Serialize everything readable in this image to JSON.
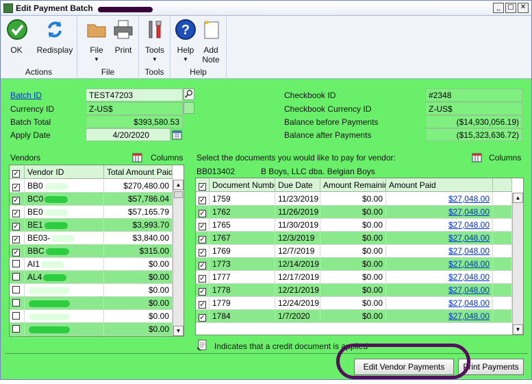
{
  "window": {
    "title": "Edit Payment Batch",
    "min": "_",
    "max": "□",
    "close": "✕"
  },
  "ribbon": {
    "ok": "OK",
    "redisplay": "Redisplay",
    "actions_label": "Actions",
    "file": "File",
    "print": "Print",
    "file_label": "File",
    "tools": "Tools",
    "tools_label": "Tools",
    "help": "Help",
    "add_note_1": "Add",
    "add_note_2": "Note",
    "help_label": "Help"
  },
  "header": {
    "batch_id_label": "Batch ID",
    "batch_id": "TEST47203",
    "currency_id_label": "Currency ID",
    "currency_id": "Z-US$",
    "batch_total_label": "Batch Total",
    "batch_total": "$393,580.53",
    "apply_date_label": "Apply Date",
    "apply_date": "4/20/2020",
    "checkbook_id_label": "Checkbook ID",
    "checkbook_id": "#2348",
    "checkbook_currency_label": "Checkbook Currency ID",
    "checkbook_currency": "Z-US$",
    "balance_before_label": "Balance before Payments",
    "balance_before": "($14,930,056.19)",
    "balance_after_label": "Balance after Payments",
    "balance_after": "($15,323,636.72)"
  },
  "vendors": {
    "title": "Vendors",
    "columns_label": "Columns",
    "col_vendor": "Vendor ID",
    "col_total": "Total Amount Paid",
    "rows": [
      {
        "id": "BB0",
        "amount": "$270,480.00",
        "checked": true
      },
      {
        "id": "BC0",
        "amount": "$57,786.04",
        "checked": true
      },
      {
        "id": "BE0",
        "amount": "$57,165.79",
        "checked": true
      },
      {
        "id": "BE1",
        "amount": "$3,993.70",
        "checked": true
      },
      {
        "id": "BE03-",
        "amount": "$3,840.00",
        "checked": true
      },
      {
        "id": "BBC",
        "amount": "$315.00",
        "checked": true
      },
      {
        "id": "AI1",
        "amount": "$0.00",
        "checked": false
      },
      {
        "id": "AL4",
        "amount": "$0.00",
        "checked": false
      },
      {
        "id": "",
        "amount": "$0.00",
        "checked": false
      },
      {
        "id": "",
        "amount": "$0.00",
        "checked": false
      },
      {
        "id": "",
        "amount": "$0.00",
        "checked": false
      },
      {
        "id": "",
        "amount": "$0.00",
        "checked": false
      }
    ]
  },
  "documents": {
    "prompt": "Select the documents you would like to pay for vendor:",
    "vendor_id": "BB013402",
    "vendor_name": "B Boys, LLC dba. Belgian Boys",
    "columns_label": "Columns",
    "col_doc": "Document Number",
    "col_due": "Due Date",
    "col_remaining": "Amount Remaining",
    "col_paid": "Amount Paid",
    "rows": [
      {
        "doc": "1759",
        "due": "11/23/2019",
        "remaining": "$0.00",
        "paid": "$27,048.00"
      },
      {
        "doc": "1762",
        "due": "11/26/2019",
        "remaining": "$0.00",
        "paid": "$27,048.00"
      },
      {
        "doc": "1765",
        "due": "11/30/2019",
        "remaining": "$0.00",
        "paid": "$27,048.00"
      },
      {
        "doc": "1767",
        "due": "12/3/2019",
        "remaining": "$0.00",
        "paid": "$27,048.00"
      },
      {
        "doc": "1769",
        "due": "12/7/2019",
        "remaining": "$0.00",
        "paid": "$27,048.00"
      },
      {
        "doc": "1773",
        "due": "12/14/2019",
        "remaining": "$0.00",
        "paid": "$27,048.00"
      },
      {
        "doc": "1777",
        "due": "12/17/2019",
        "remaining": "$0.00",
        "paid": "$27,048.00"
      },
      {
        "doc": "1778",
        "due": "12/21/2019",
        "remaining": "$0.00",
        "paid": "$27,048.00"
      },
      {
        "doc": "1779",
        "due": "12/24/2019",
        "remaining": "$0.00",
        "paid": "$27,048.00"
      },
      {
        "doc": "1784",
        "due": "1/7/2020",
        "remaining": "$0.00",
        "paid": "$27,048.00"
      }
    ],
    "credit_note": "Indicates that a credit document is applied"
  },
  "buttons": {
    "edit_vendor_payments": "Edit Vendor Payments",
    "print_payments": "Print Payments"
  },
  "colors": {
    "form_bg": "#6aef6a",
    "alt_row": "#8ce88c",
    "highlight": "#52115a",
    "link": "#0033cc"
  },
  "icons": [
    "ok-check-icon",
    "redisplay-arrows-icon",
    "folder-icon",
    "printer-icon",
    "tools-icon",
    "help-icon",
    "note-icon",
    "lookup-icon",
    "calendar-icon",
    "columns-icon",
    "credit-document-icon"
  ]
}
